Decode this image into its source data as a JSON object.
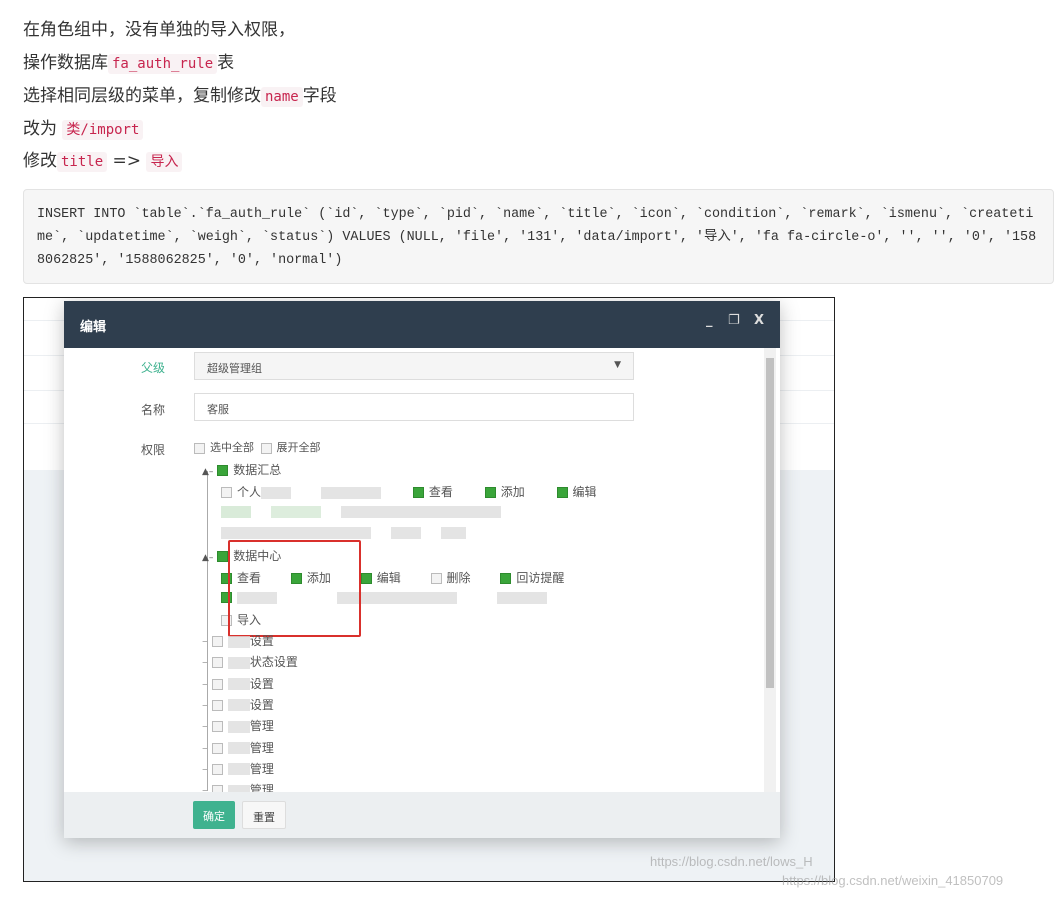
{
  "article": {
    "line1": "在角色组中，没有单独的导入权限，",
    "line2_pre": "操作数据库",
    "line2_code": "fa_auth_rule",
    "line2_post": "表",
    "line3_pre": "选择相同层级的菜单，复制修改",
    "line3_code": "name",
    "line3_post": "字段",
    "line4_pre": "改为 ",
    "line4_code": "类/import",
    "line5_pre": "修改",
    "line5_code": "title",
    "line5_mid": " => ",
    "line5_code2": "导入",
    "sql": "INSERT INTO `table`.`fa_auth_rule` (`id`, `type`, `pid`, `name`, `title`, `icon`, `condition`, `remark`, `ismenu`, `createtime`, `updatetime`, `weigh`, `status`) VALUES (NULL, 'file', '131', 'data/import', '导入', 'fa fa-circle-o', '', '', '0', '1588062825', '1588062825', '0', 'normal')"
  },
  "dialog": {
    "title": "编辑",
    "min": "_",
    "max": "❐",
    "close": "X",
    "parent_label": "父级",
    "parent_value": "超级管理组",
    "name_label": "名称",
    "name_value": "客服",
    "perm_label": "权限",
    "select_all": "选中全部",
    "expand_all": "展开全部",
    "tree": {
      "g1": "数据汇总",
      "g1_c1": "个人",
      "g1_view": "查看",
      "g1_add": "添加",
      "g1_edit": "编辑",
      "g2": "数据中心",
      "g2_view": "查看",
      "g2_add": "添加",
      "g2_edit": "编辑",
      "g2_del": "删除",
      "g2_remind": "回访提醒",
      "g2_import": "导入",
      "others": [
        "设置",
        "状态设置",
        "设置",
        "设置",
        "管理",
        "管理",
        "管理",
        "管理"
      ]
    },
    "ok": "确定",
    "reset": "重置"
  },
  "watermark_inner": "https://blog.csdn.net/lows_H",
  "watermark": "https://blog.csdn.net/weixin_41850709",
  "colors": {
    "header": "#2f3e4e",
    "ok": "#3fb28f",
    "highlight": "#d9302c",
    "code": "#c7254e"
  }
}
